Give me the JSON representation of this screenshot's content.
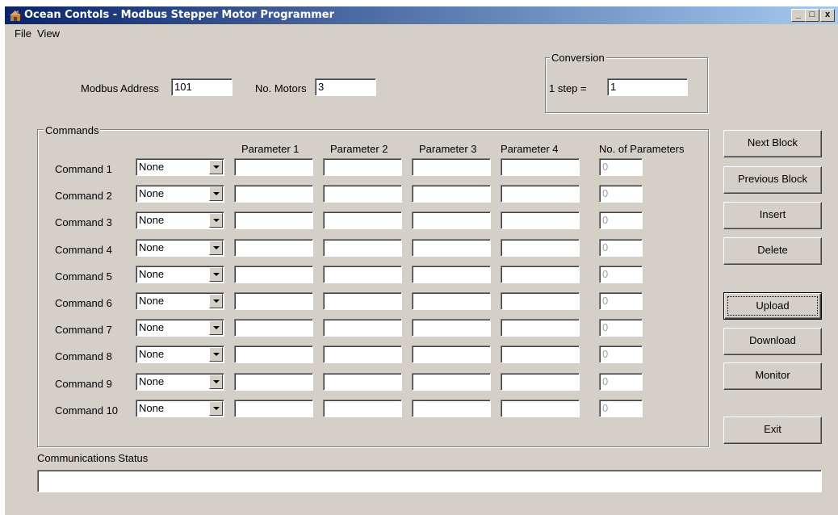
{
  "window": {
    "title": "Ocean Contols - Modbus Stepper Motor Programmer",
    "minimize": "_",
    "maximize": "□",
    "close": "x"
  },
  "menu": {
    "file": "File",
    "view": "View"
  },
  "address": {
    "label": "Modbus Address",
    "value": "101"
  },
  "motors": {
    "label": "No. Motors",
    "value": "3"
  },
  "conversion": {
    "title": "Conversion",
    "label": "1 step =",
    "value": "1"
  },
  "commands": {
    "title": "Commands",
    "headers": [
      "Parameter 1",
      "Parameter 2",
      "Parameter 3",
      "Parameter 4",
      "No. of Parameters"
    ],
    "rows": [
      {
        "label": "Command 1",
        "select": "None",
        "p1": "",
        "p2": "",
        "p3": "",
        "p4": "",
        "count": "0"
      },
      {
        "label": "Command 2",
        "select": "None",
        "p1": "",
        "p2": "",
        "p3": "",
        "p4": "",
        "count": "0"
      },
      {
        "label": "Command 3",
        "select": "None",
        "p1": "",
        "p2": "",
        "p3": "",
        "p4": "",
        "count": "0"
      },
      {
        "label": "Command 4",
        "select": "None",
        "p1": "",
        "p2": "",
        "p3": "",
        "p4": "",
        "count": "0"
      },
      {
        "label": "Command 5",
        "select": "None",
        "p1": "",
        "p2": "",
        "p3": "",
        "p4": "",
        "count": "0"
      },
      {
        "label": "Command 6",
        "select": "None",
        "p1": "",
        "p2": "",
        "p3": "",
        "p4": "",
        "count": "0"
      },
      {
        "label": "Command 7",
        "select": "None",
        "p1": "",
        "p2": "",
        "p3": "",
        "p4": "",
        "count": "0"
      },
      {
        "label": "Command 8",
        "select": "None",
        "p1": "",
        "p2": "",
        "p3": "",
        "p4": "",
        "count": "0"
      },
      {
        "label": "Command 9",
        "select": "None",
        "p1": "",
        "p2": "",
        "p3": "",
        "p4": "",
        "count": "0"
      },
      {
        "label": "Command 10",
        "select": "None",
        "p1": "",
        "p2": "",
        "p3": "",
        "p4": "",
        "count": "0"
      }
    ]
  },
  "buttons": {
    "next": "Next Block",
    "previous": "Previous Block",
    "insert": "Insert",
    "delete": "Delete",
    "upload": "Upload",
    "download": "Download",
    "monitor": "Monitor",
    "exit": "Exit"
  },
  "status": {
    "label": "Communications Status",
    "value": ""
  }
}
